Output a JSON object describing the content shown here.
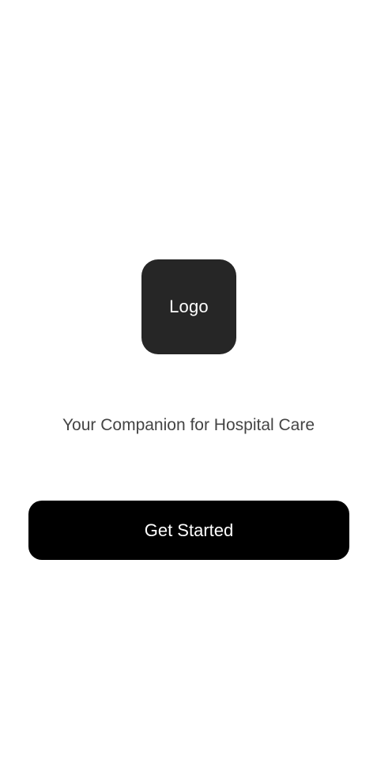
{
  "splash": {
    "logo_text": "Logo",
    "tagline": "Your Companion for Hospital Care",
    "cta_label": "Get Started"
  },
  "colors": {
    "background": "#ffffff",
    "logo_background": "#262626",
    "logo_text": "#ffffff",
    "tagline_text": "#444444",
    "button_background": "#000000",
    "button_text": "#ffffff"
  }
}
